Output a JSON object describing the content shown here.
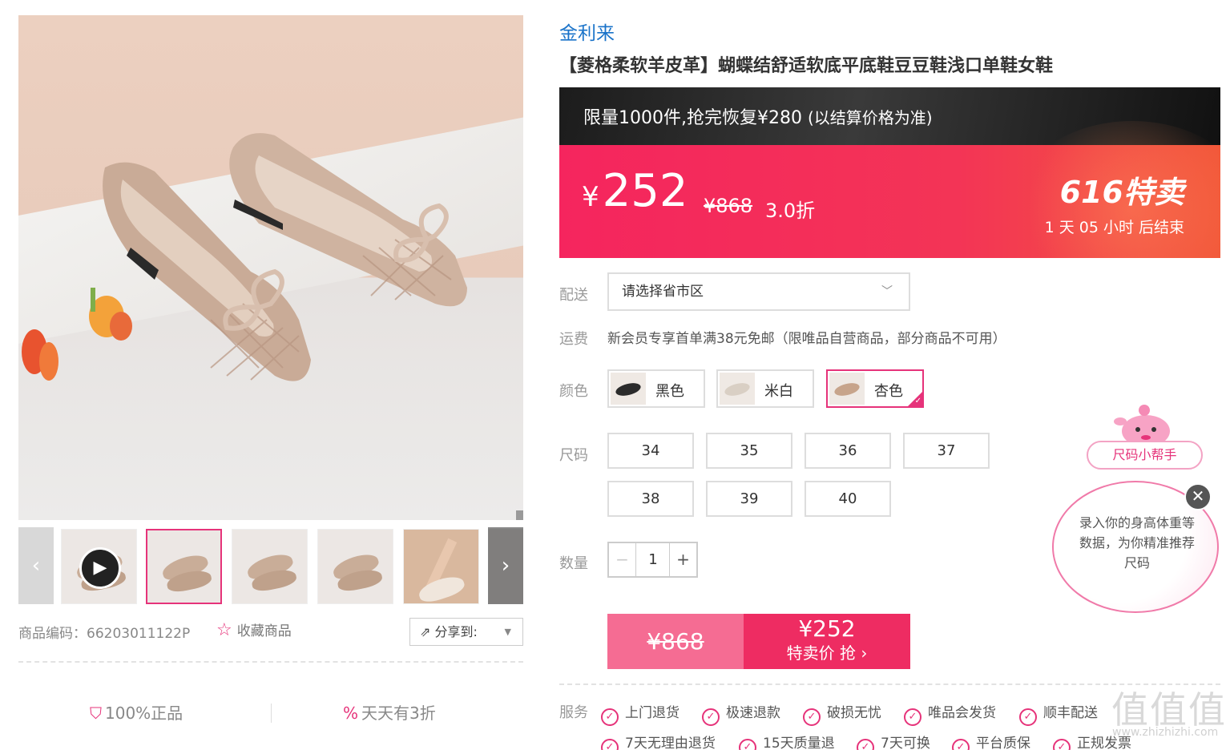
{
  "gallery": {
    "zoom_icon": "magnifier-icon",
    "prev_icon": "chevron-left-icon",
    "next_icon": "chevron-right-icon",
    "play_icon": "play-icon",
    "sku_text": "商品编码：66203011122P",
    "favorite_label": "收藏商品",
    "favorite_icon": "star-icon",
    "share_label": "分享到:",
    "share_icon": "share-icon",
    "promises": [
      {
        "label": "100%正品",
        "icon": "shield-icon"
      },
      {
        "label": "天天有3折",
        "icon": "percent-icon"
      }
    ]
  },
  "product": {
    "brand": "金利来",
    "title": "【菱格柔软羊皮革】蝴蝶结舒适软底平底鞋豆豆鞋浅口单鞋女鞋"
  },
  "promo": {
    "banner_main": "限量1000件,抢完恢复¥280",
    "banner_note": "(以结算价格为准)",
    "currency": "¥",
    "price": "252",
    "original_price": "¥868",
    "discount": "3.0折",
    "event_name": "616特卖",
    "countdown": "1 天 05 小时 后结束"
  },
  "delivery": {
    "label": "配送",
    "placeholder": "请选择省市区"
  },
  "shipping": {
    "label": "运费",
    "text": "新会员专享首单满38元免邮（限唯品自营商品，部分商品不可用）"
  },
  "colors": {
    "label": "颜色",
    "options": [
      {
        "name": "黑色",
        "swatch": "#2b2b2b",
        "selected": false
      },
      {
        "name": "米白",
        "swatch": "#d9cfc4",
        "selected": false
      },
      {
        "name": "杏色",
        "swatch": "#c7a48b",
        "selected": true
      }
    ]
  },
  "sizes": {
    "label": "尺码",
    "options": [
      "34",
      "35",
      "36",
      "37",
      "38",
      "39",
      "40"
    ]
  },
  "quantity": {
    "label": "数量",
    "minus": "−",
    "value": "1",
    "plus": "+"
  },
  "buy": {
    "original_price": "¥868",
    "price": "¥252",
    "action": "特卖价 抢 ›"
  },
  "services": {
    "label": "服务",
    "items": [
      "上门退货",
      "极速退款",
      "破损无忧",
      "唯品会发货",
      "顺丰配送",
      "7天无理由退货",
      "15天质量退",
      "7天可换",
      "平台质保",
      "正规发票"
    ]
  },
  "size_helper": {
    "title": "尺码小帮手",
    "message": "录入你的身高体重等数据，为你精准推荐尺码",
    "close_icon": "close-icon"
  },
  "watermark": {
    "logo": "值值值",
    "url": "www.zhizhizhi.com"
  },
  "colors_theme": {
    "accent": "#e6337a",
    "brand_blue": "#1a73c9",
    "promo_red": "#f5255e"
  }
}
